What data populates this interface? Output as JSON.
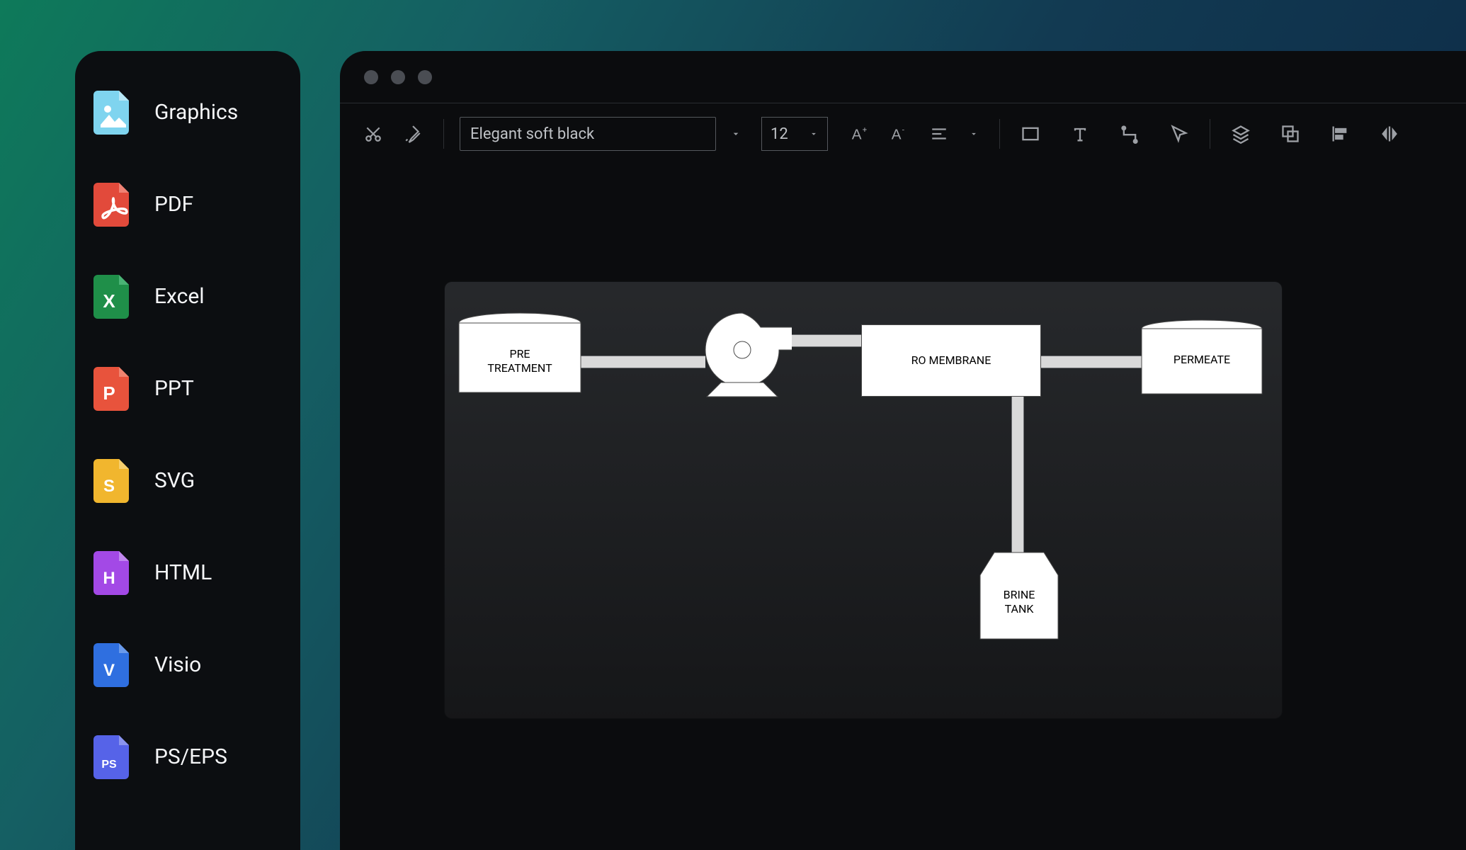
{
  "export_panel": {
    "items": [
      {
        "label": "Graphics",
        "icon": "image",
        "color": "#43c4ef"
      },
      {
        "label": "PDF",
        "icon": "pdf",
        "color": "#e24a3b"
      },
      {
        "label": "Excel",
        "icon": "excel",
        "color": "#1f8f49"
      },
      {
        "label": "PPT",
        "icon": "ppt",
        "color": "#e8533c"
      },
      {
        "label": "SVG",
        "icon": "svg",
        "color": "#f1b62e"
      },
      {
        "label": "HTML",
        "icon": "html",
        "color": "#a349e6"
      },
      {
        "label": "Visio",
        "icon": "visio",
        "color": "#2f6fe0"
      },
      {
        "label": "PS/EPS",
        "icon": "ps",
        "color": "#5663e8"
      }
    ]
  },
  "toolbar": {
    "style_name": "Elegant soft black",
    "font_size": "12"
  },
  "diagram": {
    "nodes": {
      "pre_treatment": "PRE TREATMENT",
      "ro_membrane": "RO MEMBRANE",
      "permeate": "PERMEATE",
      "brine_tank": "BRINE TANK"
    }
  }
}
